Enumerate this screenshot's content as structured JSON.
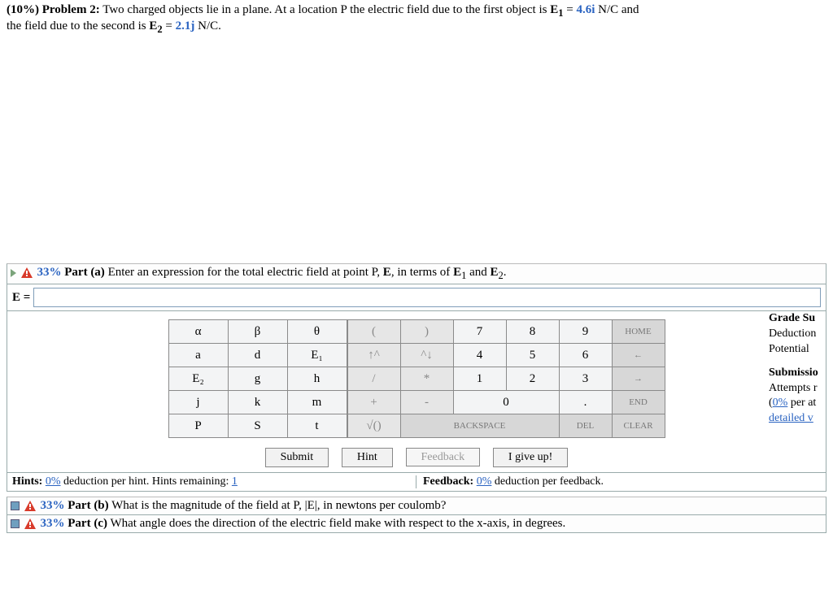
{
  "problem": {
    "weight": "(10%)",
    "label": "Problem 2:",
    "text1": "Two charged objects lie in a plane. At a location P the electric field due to the first object is ",
    "e1_lhs": "E",
    "e1_sub": "1",
    "e1_eq": " = ",
    "e1_val": "4.6i",
    "unit1": " N/C and",
    "text2": "the field due to the second is ",
    "e2_lhs": "E",
    "e2_sub": "2",
    "e2_eq": " = ",
    "e2_val": "2.1j",
    "unit2": " N/C."
  },
  "part_a": {
    "pct": "33%",
    "label": "Part (a)",
    "prompt": "Enter an expression for the total electric field at point P, ",
    "prompt_b1": "E",
    "prompt_mid": ", in terms of ",
    "prompt_e1": "E",
    "prompt_e1s": "1",
    "prompt_and": " and ",
    "prompt_e2": "E",
    "prompt_e2s": "2",
    "prompt_end": "."
  },
  "input_label": "E = ",
  "side": {
    "l1": "Grade Su",
    "l2": "Deduction",
    "l3": "Potential",
    "l4": "Submissio",
    "l5": "Attempts r",
    "l6a": "0%",
    "l6b": " per at",
    "l7": "detailed v"
  },
  "vars": [
    [
      "α",
      "β",
      "θ"
    ],
    [
      "a",
      "d",
      "E₁"
    ],
    [
      "E₂",
      "g",
      "h"
    ],
    [
      "j",
      "k",
      "m"
    ],
    [
      "P",
      "S",
      "t"
    ]
  ],
  "nums": [
    [
      "(",
      ")",
      "7",
      "8",
      "9",
      "HOME"
    ],
    [
      "↑^",
      "^↓",
      "4",
      "5",
      "6",
      "←"
    ],
    [
      "/",
      "*",
      "1",
      "2",
      "3",
      "→"
    ],
    [
      "+",
      "-",
      "0",
      "0",
      ".",
      "END"
    ],
    [
      "√()",
      "BACKSPACE",
      "BACKSPACE",
      "BACKSPACE",
      "DEL",
      "CLEAR"
    ]
  ],
  "actions": {
    "submit": "Submit",
    "hint": "Hint",
    "feedback": "Feedback",
    "giveup": "I give up!"
  },
  "hints": {
    "h_label": "Hints:",
    "h_pct": "0%",
    "h_text": " deduction per hint. Hints remaining: ",
    "h_rem": "1",
    "f_label": "Feedback:",
    "f_pct": "0%",
    "f_text": " deduction per feedback."
  },
  "part_b": {
    "pct": "33%",
    "label": "Part (b)",
    "text": "What is the magnitude of the field at P, |E|, in newtons per coulomb?"
  },
  "part_c": {
    "pct": "33%",
    "label": "Part (c)",
    "text": "What angle does the direction of the electric field make with respect to the x-axis, in degrees."
  }
}
